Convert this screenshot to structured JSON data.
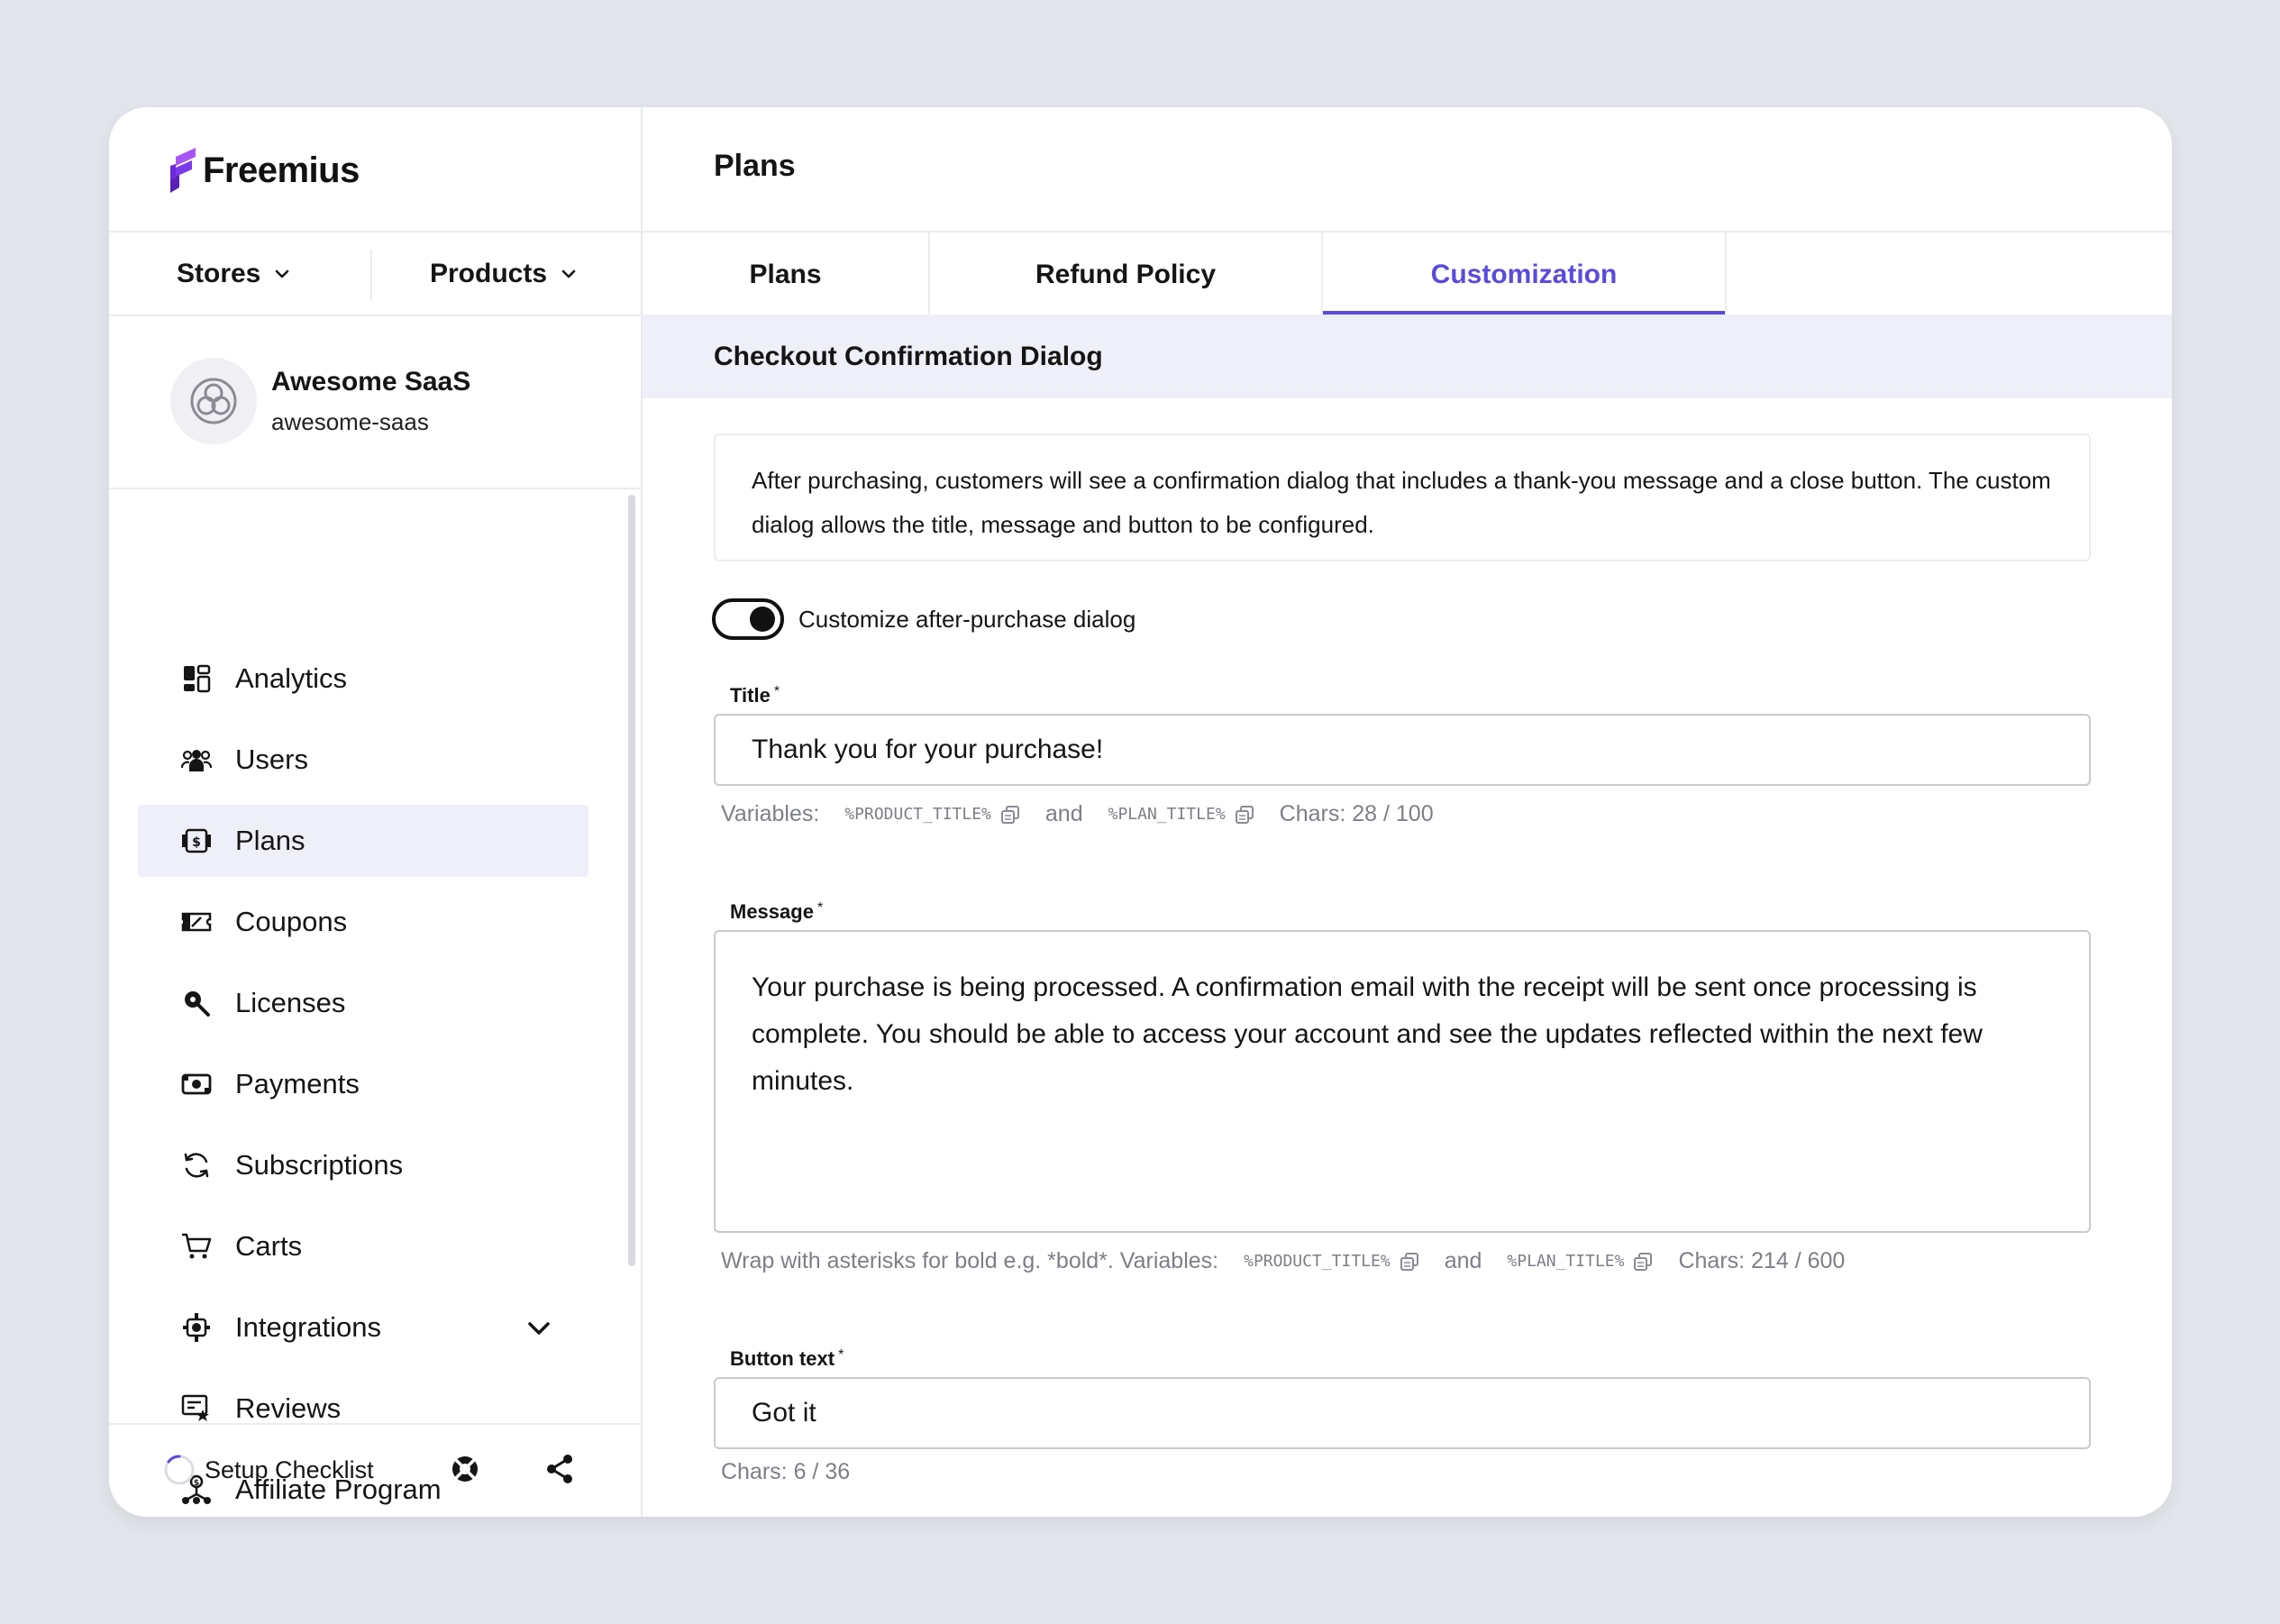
{
  "brand": {
    "name": "Freemius",
    "accent": "#5b4bdb"
  },
  "selectors": {
    "stores": "Stores",
    "products": "Products"
  },
  "store": {
    "name": "Awesome SaaS",
    "slug": "awesome-saas"
  },
  "nav": [
    {
      "label": "Analytics",
      "icon": "analytics-icon"
    },
    {
      "label": "Users",
      "icon": "users-icon"
    },
    {
      "label": "Plans",
      "icon": "plans-icon",
      "active": true
    },
    {
      "label": "Coupons",
      "icon": "coupons-icon"
    },
    {
      "label": "Licenses",
      "icon": "licenses-icon"
    },
    {
      "label": "Payments",
      "icon": "payments-icon"
    },
    {
      "label": "Subscriptions",
      "icon": "subscriptions-icon"
    },
    {
      "label": "Carts",
      "icon": "carts-icon"
    },
    {
      "label": "Integrations",
      "icon": "integrations-icon",
      "expandable": true
    },
    {
      "label": "Reviews",
      "icon": "reviews-icon"
    },
    {
      "label": "Affiliate Program",
      "icon": "affiliate-icon"
    }
  ],
  "footer": {
    "setup_checklist": "Setup Checklist"
  },
  "page": {
    "title": "Plans"
  },
  "tabs": [
    {
      "label": "Plans"
    },
    {
      "label": "Refund Policy"
    },
    {
      "label": "Customization",
      "active": true
    }
  ],
  "section": {
    "title": "Checkout Confirmation Dialog",
    "description": "After purchasing, customers will see a confirmation dialog that includes a thank-you message and a close button. The custom dialog allows the title, message and button to be configured."
  },
  "toggle": {
    "label": "Customize after-purchase dialog",
    "on": true
  },
  "fields": {
    "title": {
      "label": "Title",
      "required_mark": "*",
      "value": "Thank you for your purchase!",
      "hint_prefix": "Variables:",
      "var1": "%PRODUCT_TITLE%",
      "and": "and",
      "var2": "%PLAN_TITLE%",
      "chars": "Chars: 28 / 100"
    },
    "message": {
      "label": "Message",
      "required_mark": "*",
      "value": "Your purchase is being processed. A confirmation email with the receipt will be sent once processing is complete. You should be able to access your account and see the updates reflected within the next few minutes.",
      "hint_prefix": "Wrap with asterisks for bold e.g. *bold*. Variables:",
      "var1": "%PRODUCT_TITLE%",
      "and": "and",
      "var2": "%PLAN_TITLE%",
      "chars": "Chars: 214 / 600"
    },
    "button_text": {
      "label": "Button text",
      "required_mark": "*",
      "value": "Got it",
      "chars": "Chars: 6 / 36"
    }
  }
}
